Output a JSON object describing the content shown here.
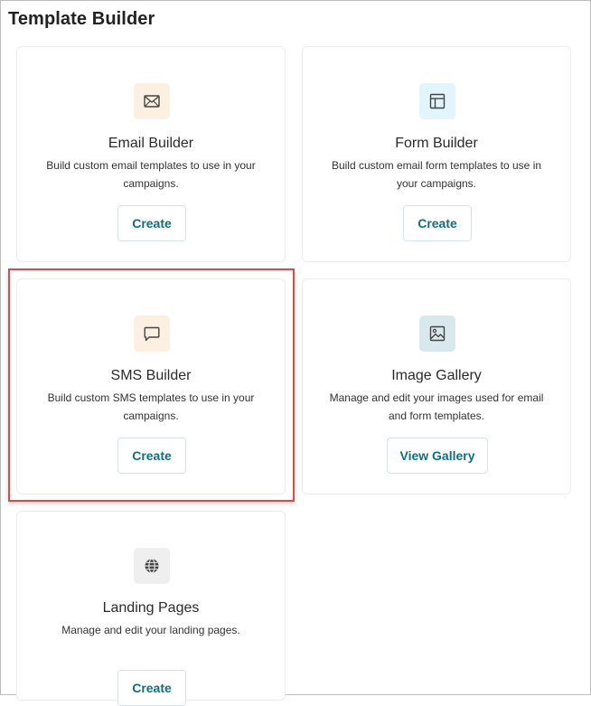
{
  "page": {
    "title": "Template Builder"
  },
  "cards": [
    {
      "title": "Email Builder",
      "description": "Build custom email templates to use in your campaigns.",
      "button_label": "Create",
      "icon": "mail-icon",
      "icon_bg": "#fdf0e0"
    },
    {
      "title": "Form Builder",
      "description": "Build custom email form templates to use in your campaigns.",
      "button_label": "Create",
      "icon": "layout-icon",
      "icon_bg": "#e3f5fc"
    },
    {
      "title": "SMS Builder",
      "description": "Build custom SMS templates to use in your campaigns.",
      "button_label": "Create",
      "icon": "chat-icon",
      "icon_bg": "#fdf0e0"
    },
    {
      "title": "Image Gallery",
      "description": "Manage and edit your images used for email and form templates.",
      "button_label": "View Gallery",
      "icon": "image-icon",
      "icon_bg": "#d9e8ec"
    },
    {
      "title": "Landing Pages",
      "description": "Manage and edit your landing pages.",
      "button_label": "Create",
      "icon": "globe-icon",
      "icon_bg": "#efefef"
    }
  ],
  "colors": {
    "button_text": "#0f6f82",
    "highlight_border": "#e0484b"
  }
}
